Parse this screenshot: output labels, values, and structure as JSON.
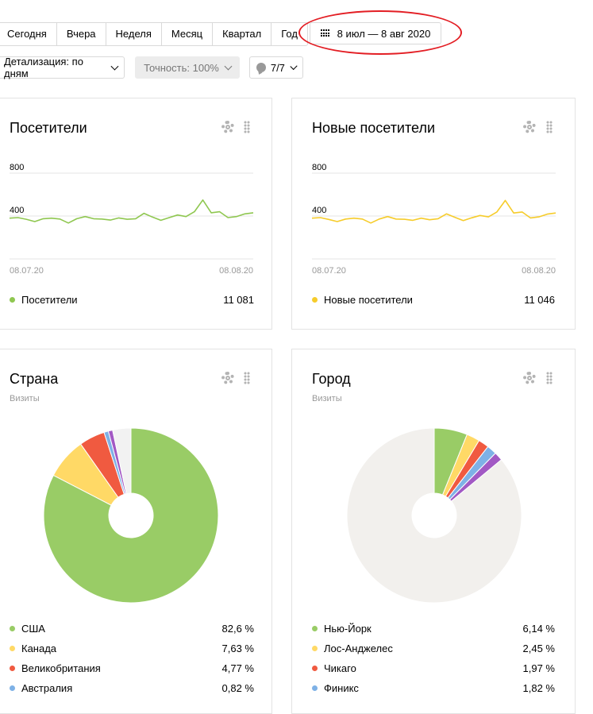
{
  "toolbar": {
    "periods": [
      "Сегодня",
      "Вчера",
      "Неделя",
      "Месяц",
      "Квартал",
      "Год"
    ],
    "date_range": "8 июл — 8 авг 2020",
    "detail": "Детализация: по дням",
    "accuracy": "Точность: 100%",
    "notes": "7/7"
  },
  "widgets": {
    "visitors": {
      "title": "Посетители",
      "legend": {
        "name": "Посетители",
        "value": "11 081",
        "color": "#8fc750"
      }
    },
    "new_visitors": {
      "title": "Новые посетители",
      "legend": {
        "name": "Новые посетители",
        "value": "11 046",
        "color": "#f6cc2b"
      }
    },
    "country": {
      "title": "Страна",
      "subtitle": "Визиты",
      "legend": [
        {
          "name": "США",
          "value": "82,6 %",
          "color": "#99cc66"
        },
        {
          "name": "Канада",
          "value": "7,63 %",
          "color": "#ffd966"
        },
        {
          "name": "Великобритания",
          "value": "4,77 %",
          "color": "#f05a40"
        },
        {
          "name": "Австралия",
          "value": "0,82 %",
          "color": "#7eb1e6"
        }
      ]
    },
    "city": {
      "title": "Город",
      "subtitle": "Визиты",
      "legend": [
        {
          "name": "Нью-Йорк",
          "value": "6,14 %",
          "color": "#99cc66"
        },
        {
          "name": "Лос-Анджелес",
          "value": "2,45 %",
          "color": "#ffd966"
        },
        {
          "name": "Чикаго",
          "value": "1,97 %",
          "color": "#f05a40"
        },
        {
          "name": "Финикс",
          "value": "1,82 %",
          "color": "#7eb1e6"
        }
      ]
    }
  },
  "chart_data": [
    {
      "type": "line",
      "series": [
        {
          "name": "Посетители",
          "color": "#8fc750",
          "values": [
            380,
            385,
            370,
            348,
            375,
            380,
            372,
            335,
            375,
            395,
            375,
            372,
            362,
            382,
            370,
            375,
            425,
            390,
            360,
            385,
            410,
            395,
            440,
            550,
            430,
            440,
            385,
            395,
            420,
            430
          ]
        }
      ],
      "y_ticks": [
        "800",
        "400"
      ],
      "ylim": [
        0,
        800
      ],
      "x_labels": [
        "08.07.20",
        "08.08.20"
      ],
      "grid": true
    },
    {
      "type": "line",
      "series": [
        {
          "name": "Новые посетители",
          "color": "#f6cc2b",
          "values": [
            380,
            385,
            368,
            348,
            372,
            380,
            372,
            335,
            372,
            395,
            372,
            370,
            360,
            380,
            365,
            375,
            420,
            388,
            358,
            383,
            405,
            392,
            438,
            545,
            428,
            438,
            382,
            392,
            418,
            428
          ]
        }
      ],
      "y_ticks": [
        "800",
        "400"
      ],
      "ylim": [
        0,
        800
      ],
      "x_labels": [
        "08.07.20",
        "08.08.20"
      ],
      "grid": true
    },
    {
      "type": "pie",
      "slices": [
        {
          "label": "США",
          "value": 82.6,
          "color": "#99cc66"
        },
        {
          "label": "Канада",
          "value": 7.63,
          "color": "#ffd966"
        },
        {
          "label": "Великобритания",
          "value": 4.77,
          "color": "#f05a40"
        },
        {
          "label": "Австралия",
          "value": 0.82,
          "color": "#7eb1e6"
        },
        {
          "label": "",
          "value": 0.8,
          "color": "#a259c4"
        },
        {
          "label": "",
          "value": 3.38,
          "color": "#f2f2f2"
        }
      ]
    },
    {
      "type": "pie",
      "slices": [
        {
          "label": "Нью-Йорк",
          "value": 6.14,
          "color": "#99cc66"
        },
        {
          "label": "Лос-Анджелес",
          "value": 2.45,
          "color": "#ffd966"
        },
        {
          "label": "Чикаго",
          "value": 1.97,
          "color": "#f05a40"
        },
        {
          "label": "Финикс",
          "value": 1.82,
          "color": "#7eb1e6"
        },
        {
          "label": "",
          "value": 1.6,
          "color": "#a259c4"
        },
        {
          "label": "",
          "value": 86.02,
          "color": "#f2f0ed"
        }
      ]
    }
  ]
}
